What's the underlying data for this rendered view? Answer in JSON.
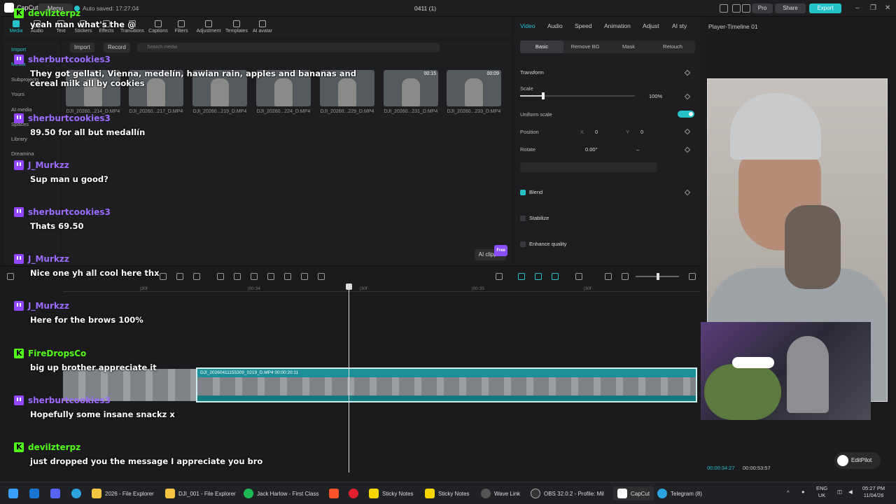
{
  "titlebar": {
    "app_name": "CapCut",
    "menu_label": "Menu",
    "autosave": "Auto saved: 17:27:04",
    "project_name": "0411 (1)",
    "pro_label": "Pro",
    "share_label": "Share",
    "export_label": "Export"
  },
  "toolbar": {
    "items": [
      "Media",
      "Audio",
      "Text",
      "Stickers",
      "Effects",
      "Transitions",
      "Captions",
      "Filters",
      "Adjustment",
      "Templates",
      "AI avatar"
    ]
  },
  "leftnav": {
    "items": [
      "Import",
      "Media",
      "Subprojects",
      "Yours",
      "AI media",
      "Spaces",
      "Library",
      "Dreamina"
    ]
  },
  "media": {
    "import_label": "Import",
    "record_label": "Record",
    "search_placeholder": "Search media",
    "clips": [
      {
        "name": "DJI_20260...214_D.MP4",
        "duration": ""
      },
      {
        "name": "DJI_20260...217_D.MP4",
        "duration": ""
      },
      {
        "name": "DJI_20260...219_D.MP4",
        "duration": ""
      },
      {
        "name": "DJI_20260...224_D.MP4",
        "duration": ""
      },
      {
        "name": "DJI_20260...229_D.MP4",
        "duration": ""
      },
      {
        "name": "DJI_20260...231_D.MP4",
        "duration": "00:15"
      },
      {
        "name": "DJI_20260...233_D.MP4",
        "duration": "00:09"
      }
    ],
    "ai_clipper_label": "AI clipper",
    "ai_clipper_badge": "Free"
  },
  "props": {
    "tabs": [
      "Video",
      "Audio",
      "Speed",
      "Animation",
      "Adjust",
      "AI sty"
    ],
    "subtabs": [
      "Basic",
      "Remove BG",
      "Mask",
      "Retouch"
    ],
    "transform_label": "Transform",
    "scale_label": "Scale",
    "scale_value": "100%",
    "scale_fraction": 0.2,
    "uniform_scale_label": "Uniform scale",
    "position_label": "Position",
    "pos_x_label": "X",
    "pos_x": "0",
    "pos_y_label": "Y",
    "pos_y": "0",
    "rotate_label": "Rotate",
    "rotate_value": "0.00°",
    "rotate_extra": "–",
    "blend_label": "Blend",
    "stabilize_label": "Stabilize",
    "enhance_label": "Enhance quality"
  },
  "player": {
    "title": "Player-Timeline 01",
    "current_time": "00:00:34:27",
    "total_time": "00:00:53:57",
    "editpilot_label": "EditPilot"
  },
  "timeline": {
    "ticks": [
      "|30f",
      "|00:34",
      "|30f",
      "|00:35",
      "|30f"
    ],
    "clip_label": "DJI_20260411155309_0219_D.MP4  00:00:20:11"
  },
  "chat": [
    {
      "user": "devilzterpz",
      "platform": "kick",
      "text": "yeah man what's the @"
    },
    {
      "user": "sherburtcookies3",
      "platform": "twitch",
      "text": "They got gellati, Vienna, medelín, hawian rain, apples and bananas and cereal milk all by cookies"
    },
    {
      "user": "sherburtcookies3",
      "platform": "twitch",
      "text": "89.50 for all but medallín"
    },
    {
      "user": "J_Murkzz",
      "platform": "twitch",
      "text": "Sup man u good?"
    },
    {
      "user": "sherburtcookies3",
      "platform": "twitch",
      "text": "Thats 69.50"
    },
    {
      "user": "J_Murkzz",
      "platform": "twitch",
      "text": "Nice one yh all cool here thx"
    },
    {
      "user": "J_Murkzz",
      "platform": "twitch",
      "text": "Here for the brows 100%"
    },
    {
      "user": "FireDropsCo",
      "platform": "kick",
      "text": "big up brother appreciate it"
    },
    {
      "user": "sherburtcookies3",
      "platform": "twitch",
      "text": "Hopefully some insane snackz x"
    },
    {
      "user": "devilzterpz",
      "platform": "kick",
      "text": "just dropped you the message I appreciate you bro"
    }
  ],
  "taskbar": {
    "apps": [
      "2026 - File Explorer",
      "DJI_001 - File Explorer",
      "Jack Harlow - First Class",
      "Sticky Notes",
      "Sticky Notes",
      "Wave Link",
      "OBS 32.0.2 - Profile: Mil",
      "CapCut",
      "Telegram (8)"
    ],
    "lang1": "ENG",
    "lang2": "UK",
    "time": "05:27 PM",
    "date": "11/04/26"
  },
  "colors": {
    "accent": "#25c2c9",
    "twitch": "#9147ff",
    "kick": "#53fc18"
  }
}
